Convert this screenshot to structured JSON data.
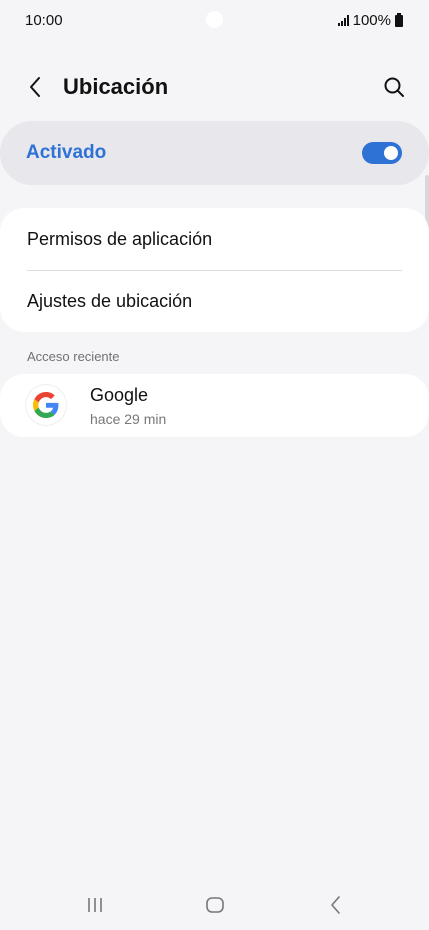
{
  "status_bar": {
    "time": "10:00",
    "battery_text": "100%"
  },
  "header": {
    "title": "Ubicación",
    "back_icon": "chevron-left-icon",
    "search_icon": "search-icon"
  },
  "master_switch": {
    "label": "Activado",
    "enabled": true,
    "accent_color": "#2f72d6"
  },
  "settings": {
    "items": [
      {
        "label": "Permisos de aplicación"
      },
      {
        "label": "Ajustes de ubicación"
      }
    ]
  },
  "recent_access": {
    "header": "Acceso reciente",
    "items": [
      {
        "name": "Google",
        "time": "hace 29 min",
        "icon": "google-icon"
      }
    ]
  },
  "nav": {
    "recents_icon": "recents-icon",
    "home_icon": "home-icon",
    "back_icon": "back-icon"
  }
}
